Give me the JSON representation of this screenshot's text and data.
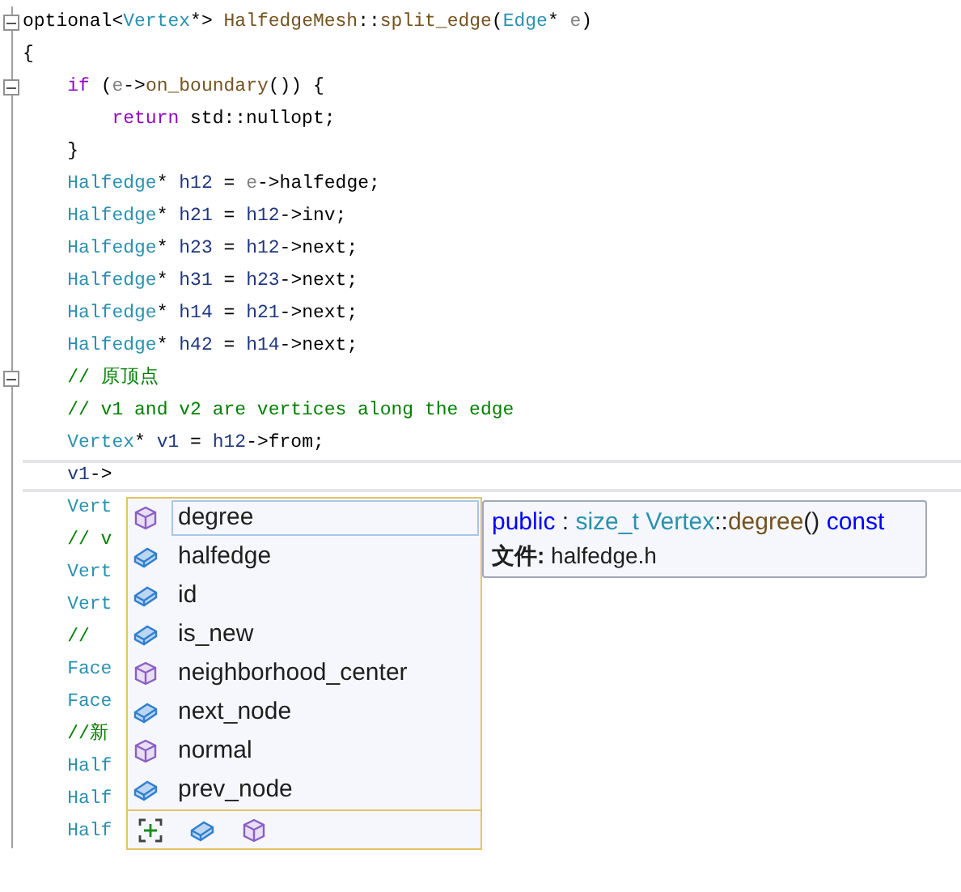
{
  "code": {
    "lines": [
      {
        "fold": true,
        "current": false,
        "segments": [
          {
            "kind": "plain",
            "text": "optional<"
          },
          {
            "kind": "type",
            "text": "Vertex"
          },
          {
            "kind": "plain",
            "text": "*> "
          },
          {
            "kind": "func",
            "text": "HalfedgeMesh"
          },
          {
            "kind": "plain",
            "text": "::"
          },
          {
            "kind": "func",
            "text": "split_edge"
          },
          {
            "kind": "plain",
            "text": "("
          },
          {
            "kind": "type",
            "text": "Edge"
          },
          {
            "kind": "plain",
            "text": "* "
          },
          {
            "kind": "param",
            "text": "e"
          },
          {
            "kind": "plain",
            "text": ")"
          }
        ]
      },
      {
        "fold": false,
        "current": false,
        "segments": [
          {
            "kind": "plain",
            "text": "{"
          }
        ]
      },
      {
        "fold": true,
        "current": false,
        "segments": [
          {
            "kind": "keyword",
            "text": "    if"
          },
          {
            "kind": "plain",
            "text": " ("
          },
          {
            "kind": "param",
            "text": "e"
          },
          {
            "kind": "plain",
            "text": "->"
          },
          {
            "kind": "func",
            "text": "on_boundary"
          },
          {
            "kind": "plain",
            "text": "()) {"
          }
        ]
      },
      {
        "fold": false,
        "current": false,
        "segments": [
          {
            "kind": "keyword",
            "text": "        return"
          },
          {
            "kind": "plain",
            "text": " std::nullopt;"
          }
        ]
      },
      {
        "fold": false,
        "current": false,
        "segments": [
          {
            "kind": "plain",
            "text": "    }"
          }
        ]
      },
      {
        "fold": false,
        "current": false,
        "segments": [
          {
            "kind": "type",
            "text": "    Halfedge"
          },
          {
            "kind": "plain",
            "text": "* "
          },
          {
            "kind": "var",
            "text": "h12"
          },
          {
            "kind": "plain",
            "text": " = "
          },
          {
            "kind": "param",
            "text": "e"
          },
          {
            "kind": "plain",
            "text": "->halfedge;"
          }
        ]
      },
      {
        "fold": false,
        "current": false,
        "segments": [
          {
            "kind": "type",
            "text": "    Halfedge"
          },
          {
            "kind": "plain",
            "text": "* "
          },
          {
            "kind": "var",
            "text": "h21"
          },
          {
            "kind": "plain",
            "text": " = "
          },
          {
            "kind": "var",
            "text": "h12"
          },
          {
            "kind": "plain",
            "text": "->inv;"
          }
        ]
      },
      {
        "fold": false,
        "current": false,
        "segments": [
          {
            "kind": "type",
            "text": "    Halfedge"
          },
          {
            "kind": "plain",
            "text": "* "
          },
          {
            "kind": "var",
            "text": "h23"
          },
          {
            "kind": "plain",
            "text": " = "
          },
          {
            "kind": "var",
            "text": "h12"
          },
          {
            "kind": "plain",
            "text": "->next;"
          }
        ]
      },
      {
        "fold": false,
        "current": false,
        "segments": [
          {
            "kind": "type",
            "text": "    Halfedge"
          },
          {
            "kind": "plain",
            "text": "* "
          },
          {
            "kind": "var",
            "text": "h31"
          },
          {
            "kind": "plain",
            "text": " = "
          },
          {
            "kind": "var",
            "text": "h23"
          },
          {
            "kind": "plain",
            "text": "->next;"
          }
        ]
      },
      {
        "fold": false,
        "current": false,
        "segments": [
          {
            "kind": "type",
            "text": "    Halfedge"
          },
          {
            "kind": "plain",
            "text": "* "
          },
          {
            "kind": "var",
            "text": "h14"
          },
          {
            "kind": "plain",
            "text": " = "
          },
          {
            "kind": "var",
            "text": "h21"
          },
          {
            "kind": "plain",
            "text": "->next;"
          }
        ]
      },
      {
        "fold": false,
        "current": false,
        "segments": [
          {
            "kind": "type",
            "text": "    Halfedge"
          },
          {
            "kind": "plain",
            "text": "* "
          },
          {
            "kind": "var",
            "text": "h42"
          },
          {
            "kind": "plain",
            "text": " = "
          },
          {
            "kind": "var",
            "text": "h14"
          },
          {
            "kind": "plain",
            "text": "->next;"
          }
        ]
      },
      {
        "fold": true,
        "current": false,
        "segments": [
          {
            "kind": "comment",
            "text": "    // 原顶点"
          }
        ]
      },
      {
        "fold": false,
        "current": false,
        "segments": [
          {
            "kind": "comment",
            "text": "    // v1 and v2 are vertices along the edge"
          }
        ]
      },
      {
        "fold": false,
        "current": false,
        "segments": [
          {
            "kind": "type",
            "text": "    Vertex"
          },
          {
            "kind": "plain",
            "text": "* "
          },
          {
            "kind": "var",
            "text": "v1"
          },
          {
            "kind": "plain",
            "text": " = "
          },
          {
            "kind": "var",
            "text": "h12"
          },
          {
            "kind": "plain",
            "text": "->from;"
          }
        ]
      },
      {
        "fold": false,
        "current": true,
        "segments": [
          {
            "kind": "var",
            "text": "    v1"
          },
          {
            "kind": "plain",
            "text": "->"
          }
        ]
      },
      {
        "fold": false,
        "current": false,
        "segments": [
          {
            "kind": "type",
            "text": "    Vert"
          }
        ]
      },
      {
        "fold": false,
        "current": false,
        "segments": [
          {
            "kind": "comment",
            "text": "    // v"
          }
        ]
      },
      {
        "fold": false,
        "current": false,
        "segments": [
          {
            "kind": "type",
            "text": "    Vert"
          }
        ]
      },
      {
        "fold": false,
        "current": false,
        "segments": [
          {
            "kind": "type",
            "text": "    Vert"
          }
        ]
      },
      {
        "fold": false,
        "current": false,
        "segments": [
          {
            "kind": "comment",
            "text": "    //"
          }
        ]
      },
      {
        "fold": false,
        "current": false,
        "segments": [
          {
            "kind": "type",
            "text": "    Face"
          }
        ]
      },
      {
        "fold": false,
        "current": false,
        "segments": [
          {
            "kind": "type",
            "text": "    Face"
          }
        ]
      },
      {
        "fold": false,
        "current": false,
        "segments": [
          {
            "kind": "comment",
            "text": "    //新"
          }
        ]
      },
      {
        "fold": false,
        "current": false,
        "segments": [
          {
            "kind": "type",
            "text": "    Half"
          }
        ]
      },
      {
        "fold": false,
        "current": false,
        "segments": [
          {
            "kind": "type",
            "text": "    Half"
          }
        ]
      },
      {
        "fold": false,
        "current": false,
        "segments": [
          {
            "kind": "type",
            "text": "    Half"
          }
        ]
      }
    ]
  },
  "completion": {
    "items": [
      {
        "label": "degree",
        "kind": "method",
        "selected": true
      },
      {
        "label": "halfedge",
        "kind": "field",
        "selected": false
      },
      {
        "label": "id",
        "kind": "field",
        "selected": false
      },
      {
        "label": "is_new",
        "kind": "field",
        "selected": false
      },
      {
        "label": "neighborhood_center",
        "kind": "method",
        "selected": false
      },
      {
        "label": "next_node",
        "kind": "field",
        "selected": false
      },
      {
        "label": "normal",
        "kind": "method",
        "selected": false
      },
      {
        "label": "prev_node",
        "kind": "field",
        "selected": false
      }
    ],
    "filters": [
      {
        "kind": "snippet"
      },
      {
        "kind": "field"
      },
      {
        "kind": "method"
      }
    ]
  },
  "tooltip": {
    "signature": [
      {
        "kind": "keyword",
        "text": "public"
      },
      {
        "kind": "plain",
        "text": " : "
      },
      {
        "kind": "type",
        "text": "size_t Vertex"
      },
      {
        "kind": "plain",
        "text": "::"
      },
      {
        "kind": "func",
        "text": "degree"
      },
      {
        "kind": "plain",
        "text": "()"
      },
      {
        "kind": "keyword",
        "text": " const"
      }
    ],
    "file": "**文件:** halfedge.h"
  }
}
